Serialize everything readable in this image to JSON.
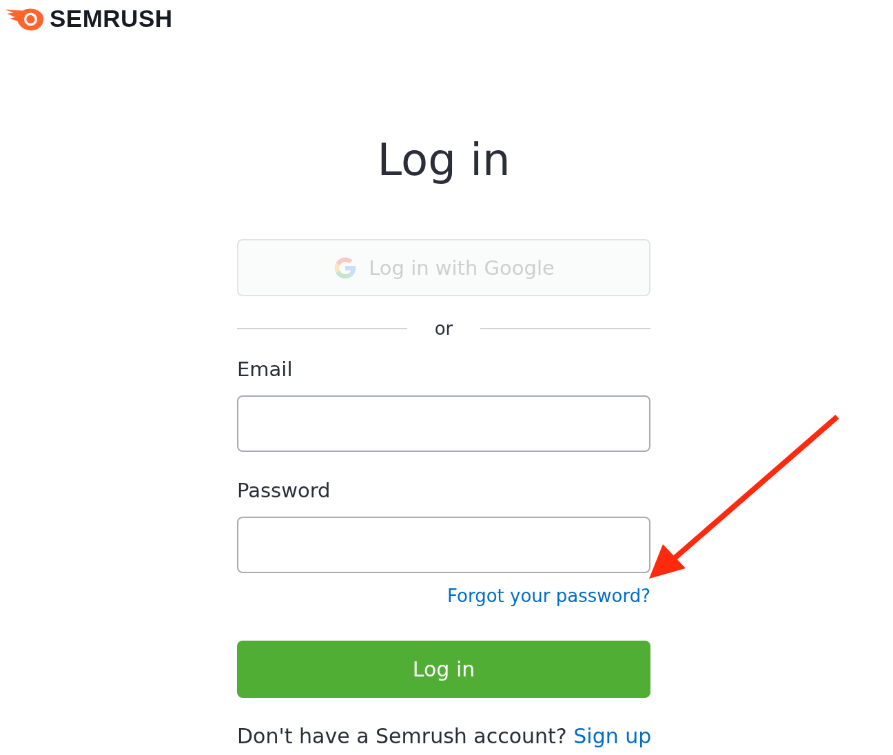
{
  "logo": {
    "text": "SEMRUSH"
  },
  "title": "Log in",
  "google_button": {
    "label": "Log in with Google",
    "disabled": true
  },
  "divider": "or",
  "fields": [
    {
      "label": "Email"
    },
    {
      "label": "Password"
    }
  ],
  "forgot_link": "Forgot your password?",
  "submit_button": "Log in",
  "footer": {
    "text": "Don't have a Semrush account?",
    "link": "Sign up"
  },
  "annotation": {
    "kind": "arrow"
  }
}
